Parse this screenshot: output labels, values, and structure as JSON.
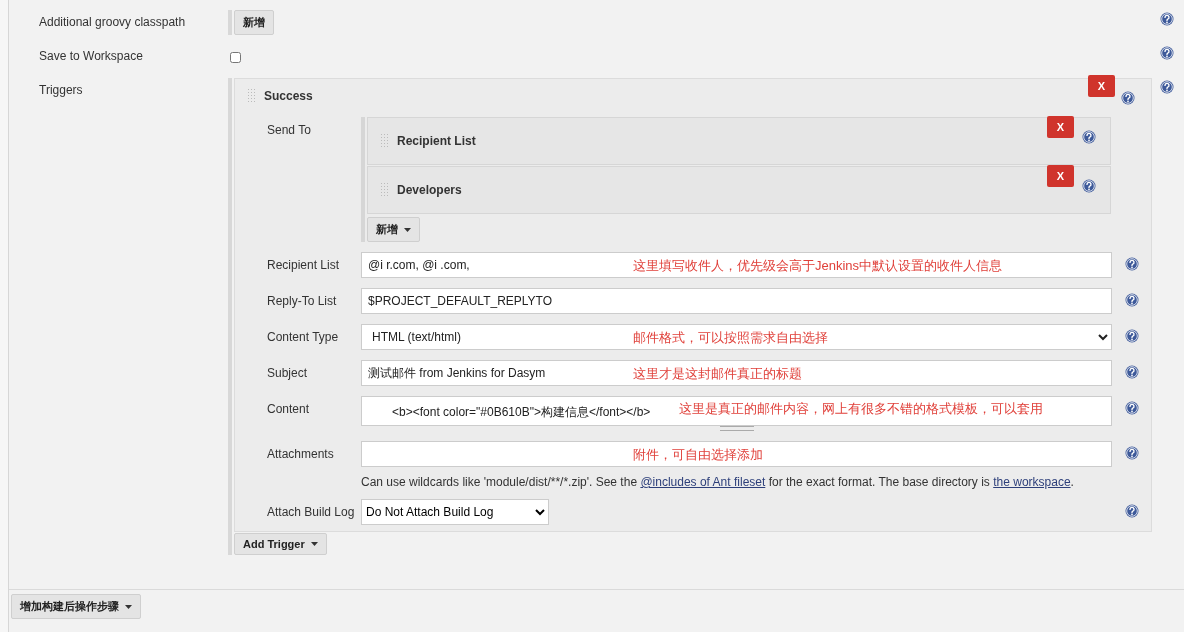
{
  "top_rows": [
    {
      "kind": "button",
      "label": "Additional groovy classpath",
      "button": "新增"
    },
    {
      "kind": "checkbox",
      "label": "Save to Workspace",
      "checked": false
    }
  ],
  "triggers": {
    "label": "Triggers",
    "add_button": "Add Trigger",
    "items": [
      {
        "title": "Success",
        "delete": "X",
        "send_to": {
          "label": "Send To",
          "add_button": "新增",
          "items": [
            {
              "title": "Recipient List",
              "delete": "X"
            },
            {
              "title": "Developers",
              "delete": "X"
            }
          ]
        },
        "fields": [
          {
            "kind": "text",
            "label": "Recipient List",
            "value": "@i r.com, @i .com,",
            "annotation": "这里填写收件人，优先级会高于Jenkins中默认设置的收件人信息"
          },
          {
            "kind": "text",
            "label": "Reply-To List",
            "value": "$PROJECT_DEFAULT_REPLYTO"
          },
          {
            "kind": "select",
            "label": "Content Type",
            "value": "HTML (text/html)",
            "annotation": "邮件格式，可以按照需求自由选择"
          },
          {
            "kind": "text",
            "label": "Subject",
            "value": "测试邮件 from Jenkins for Dasym",
            "annotation": "这里才是这封邮件真正的标题"
          },
          {
            "kind": "textarea",
            "label": "Content",
            "value": "<b><font color=\"#0B610B\">构建信息</font></b>",
            "annotation": "这里是真正的邮件内容，网上有很多不错的格式模板，可以套用"
          },
          {
            "kind": "text",
            "label": "Attachments",
            "annotation": "附件，可自由选择添加",
            "help_text": [
              {
                "link": false,
                "text": "Can use wildcards like 'module/dist/**/*.zip'. See the "
              },
              {
                "link": true,
                "text": "@includes of Ant fileset"
              },
              {
                "link": false,
                "text": " for the exact format. The base directory is "
              },
              {
                "link": true,
                "text": "the workspace"
              },
              {
                "link": false,
                "text": "."
              }
            ]
          },
          {
            "kind": "select-small",
            "label": "Attach Build Log",
            "value": "Do Not Attach Build Log"
          }
        ]
      }
    ]
  },
  "footer": {
    "button": "增加构建后操作步骤"
  }
}
